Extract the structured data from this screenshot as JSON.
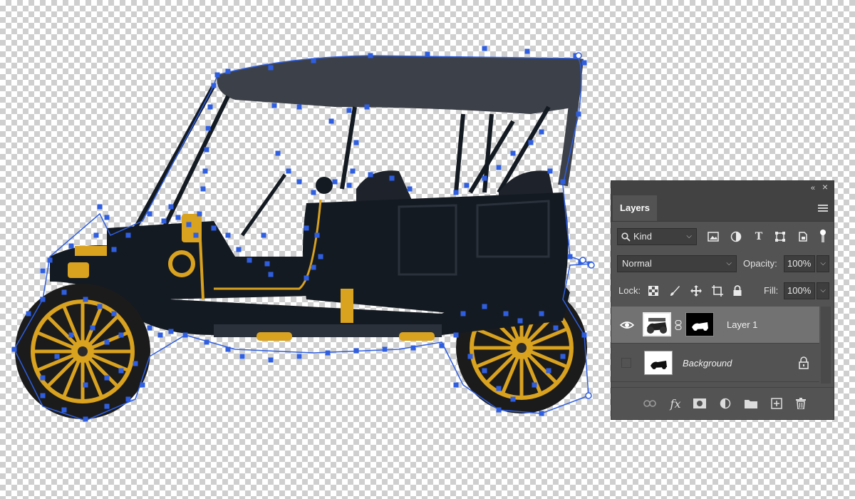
{
  "colors": {
    "path_handle": "#2f5fe0",
    "panel_bg": "#535353",
    "panel_dark": "#424242",
    "field_bg": "#3e3e3e",
    "selected_row": "#727272",
    "car_body": "#141a22",
    "car_top": "#3c4048",
    "brass": "#d9a21f",
    "tire": "#1b1b1b"
  },
  "panel": {
    "topbar": {
      "collapse_glyph": "«",
      "close_glyph": "×"
    },
    "tab_label": "Layers",
    "filter": {
      "kind_label": "Kind",
      "icons": [
        "image-filter-icon",
        "adjustment-filter-icon",
        "type-filter-icon",
        "shape-filter-icon",
        "smart-object-filter-icon"
      ]
    },
    "blend_mode": "Normal",
    "opacity_label": "Opacity:",
    "opacity_value": "100%",
    "lock_label": "Lock:",
    "lock_icons": [
      "lock-transparent-pixels-icon",
      "lock-image-pixels-icon",
      "lock-position-icon",
      "lock-artboard-icon",
      "lock-all-icon"
    ],
    "fill_label": "Fill:",
    "fill_value": "100%",
    "layers": [
      {
        "name": "Layer 1",
        "visible": true,
        "selected": true,
        "has_mask": true
      },
      {
        "name": "Background",
        "visible": false,
        "selected": false,
        "locked": true
      }
    ],
    "bottom_icons": [
      "link-layers-icon",
      "layer-effects-icon",
      "add-mask-icon",
      "new-adjustment-layer-icon",
      "new-group-icon",
      "new-layer-icon",
      "delete-layer-icon"
    ],
    "fx_text": "fx"
  }
}
